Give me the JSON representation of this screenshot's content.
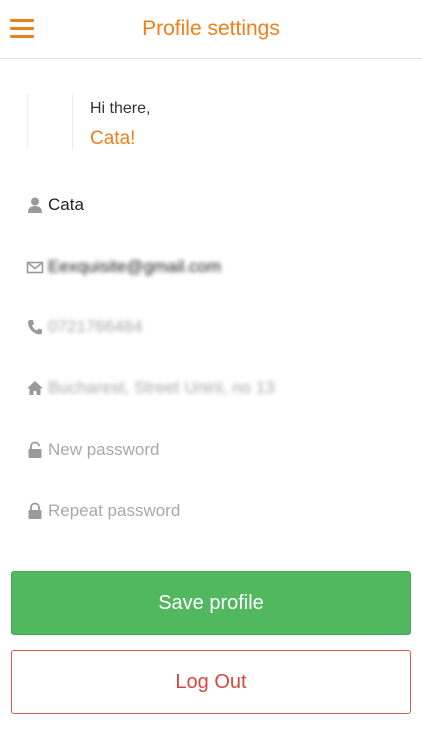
{
  "header": {
    "title": "Profile settings",
    "menu_icon": "hamburger-menu-icon",
    "accent_color": "#ef7f1a"
  },
  "profile": {
    "greeting": "Hi there,",
    "username": "Cata!"
  },
  "fields": {
    "name": {
      "icon": "person-icon",
      "value": "Cata"
    },
    "email": {
      "icon": "envelope-icon",
      "value": "Eexquisite@gmail.com"
    },
    "phone": {
      "icon": "phone-icon",
      "value": "0721766484"
    },
    "address": {
      "icon": "home-icon",
      "value": "Bucharest, Street Unirii, no 13"
    },
    "new_password": {
      "icon": "lock-open-icon",
      "placeholder": "New password"
    },
    "repeat_password": {
      "icon": "lock-icon",
      "placeholder": "Repeat password"
    }
  },
  "buttons": {
    "save_label": "Save profile",
    "save_color": "#52b85f",
    "logout_label": "Log Out",
    "logout_color": "#d04a3f"
  }
}
